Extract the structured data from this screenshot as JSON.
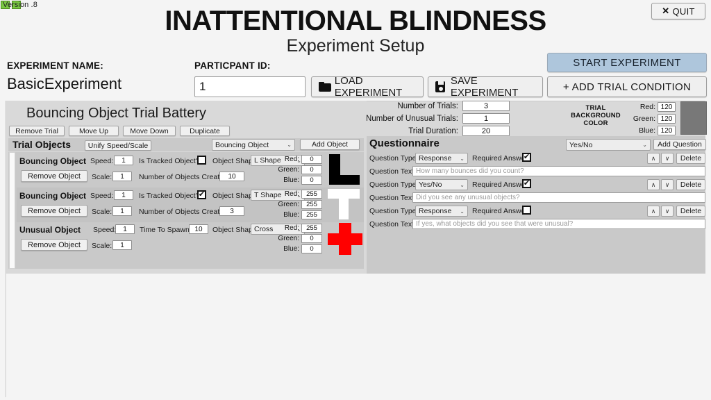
{
  "version": "Version .8",
  "title": "INATTENTIONAL BLINDNESS",
  "subtitle": "Experiment Setup",
  "quit": {
    "label": "QUIT",
    "icon": "close-icon",
    "glyph": "✕"
  },
  "header": {
    "experiment_name_label": "EXPERIMENT NAME:",
    "experiment_name_value": "BasicExperiment",
    "participant_id_label": "PARTICPANT ID:",
    "participant_id_value": "1",
    "load_label": "LOAD EXPERIMENT",
    "save_label": "SAVE EXPERIMENT",
    "start_label": "START EXPERIMENT",
    "add_trial_label": "+ ADD TRIAL CONDITION",
    "start_color": "#aec6dc"
  },
  "settings": {
    "rows": [
      {
        "label": "Number of Trials:",
        "value": "3"
      },
      {
        "label": "Number of Unusual Trials:",
        "value": "1"
      },
      {
        "label": "Trial Duration:",
        "value": "20"
      }
    ],
    "bg_color_label": "TRIAL BACKGROUND COLOR",
    "rgb": [
      {
        "label": "Red:",
        "value": "120"
      },
      {
        "label": "Green:",
        "value": "120"
      },
      {
        "label": "Blue:",
        "value": "120"
      }
    ],
    "swatch_color": "#787878"
  },
  "trial": {
    "battery_title": "Bouncing Object Trial Battery",
    "buttons": {
      "remove_trial": "Remove Trial",
      "move_up": "Move Up",
      "move_down": "Move Down",
      "duplicate": "Duplicate"
    },
    "objects_title": "Trial Objects",
    "unify_label": "Unify Speed/Scale",
    "object_type_selected": "Bouncing Object",
    "add_object_label": "Add Object",
    "remove_object_label": "Remove Object",
    "labels": {
      "speed": "Speed:",
      "scale": "Scale:",
      "is_tracked": "Is Tracked Object?",
      "object_shape": "Object Shape:",
      "num_created": "Number of Objects Created:",
      "time_to_spawn": "Time To Spawn:",
      "red": "Red:",
      "green": "Green:",
      "blue": "Blue:"
    },
    "objects": [
      {
        "name": "Bouncing Object",
        "speed": "1",
        "scale": "1",
        "tracked": false,
        "shape": "L Shape",
        "num_created": "10",
        "red": "0",
        "green": "0",
        "blue": "0",
        "preview_color": "#000000",
        "preview_shape": "L"
      },
      {
        "name": "Bouncing Object",
        "speed": "1",
        "scale": "1",
        "tracked": true,
        "shape": "T Shape",
        "num_created": "3",
        "red": "255",
        "green": "255",
        "blue": "255",
        "preview_color": "#ffffff",
        "preview_shape": "T"
      },
      {
        "name": "Unusual Object",
        "speed": "1",
        "scale": "1",
        "time_to_spawn": "10",
        "shape": "Cross",
        "red": "255",
        "green": "0",
        "blue": "0",
        "preview_color": "#ff0000",
        "preview_shape": "Cross"
      }
    ]
  },
  "questionnaire": {
    "title": "Questionnaire",
    "new_question_type": "Yes/No",
    "add_question_label": "Add Question",
    "labels": {
      "question_type": "Question Type:",
      "required_answer": "Required Answer:",
      "question_text": "Question Text:",
      "delete": "Delete",
      "move_up_icon": "chevron-up-icon",
      "move_down_icon": "chevron-down-icon"
    },
    "questions": [
      {
        "type": "Response",
        "required": true,
        "text": "How many bounces did you count?"
      },
      {
        "type": "Yes/No",
        "required": true,
        "text": "Did you see any unusual objects?"
      },
      {
        "type": "Response",
        "required": false,
        "text": "If yes, what objects did you see that were unusual?"
      }
    ]
  },
  "glyphs": {
    "check": "✔",
    "chevron_down": "⌄",
    "up": "∧",
    "down": "∨"
  }
}
